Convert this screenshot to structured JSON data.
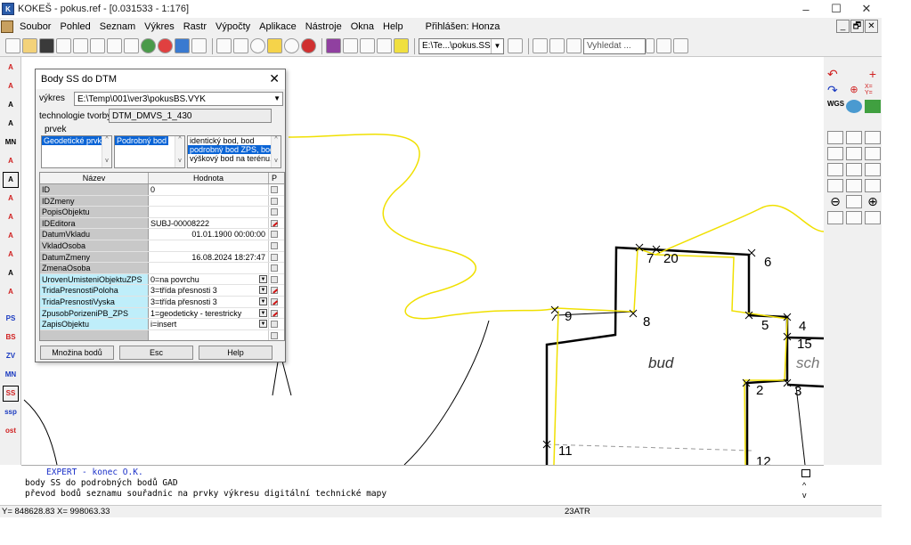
{
  "window": {
    "title": "KOKEŠ - pokus.ref - [0.031533 - 1:176]",
    "controls": [
      "–",
      "☐",
      "✕"
    ]
  },
  "menu": {
    "items": [
      "Soubor",
      "Pohled",
      "Seznam",
      "Výkres",
      "Rastr",
      "Výpočty",
      "Aplikace",
      "Nástroje",
      "Okna",
      "Help"
    ],
    "user": "Přihlášen: Honza",
    "mdi": [
      "_",
      "🗗",
      "✕"
    ]
  },
  "toolbar": {
    "path_combo": "E:\\Te...\\pokus.SS",
    "search_placeholder": "Vyhledat ..."
  },
  "left_toolbar": [
    "A",
    "A",
    "A",
    "A",
    "MN",
    "A",
    "A",
    "A",
    "A",
    "A",
    "A",
    "A",
    "A",
    "PS",
    "BS",
    "ZV",
    "MN",
    "SS",
    "ssp",
    "ost"
  ],
  "dialog": {
    "title": "Body SS do DTM",
    "vykres_label": "výkres",
    "vykres_value": "E:\\Temp\\001\\ver3\\pokusBS.VYK",
    "technologie_label": "technologie tvorby",
    "technologie_value": "DTM_DMVS_1_430",
    "prvek_label": "prvek",
    "list1": [
      "Geodetické prvky"
    ],
    "list2": [
      "Podrobný bod"
    ],
    "list3": [
      "identický bod, bod",
      "podrobný bod ZPS, bod",
      "výškový bod na terénu,"
    ],
    "grid_headers": [
      "Název",
      "Hodnota",
      "P"
    ],
    "rows": [
      {
        "name": "ID",
        "value": "0",
        "align": "left",
        "dd": false,
        "p": "plain",
        "cyan": false
      },
      {
        "name": "IDZmeny",
        "value": "",
        "align": "left",
        "dd": false,
        "p": "plain",
        "cyan": false
      },
      {
        "name": "PopisObjektu",
        "value": "",
        "align": "left",
        "dd": false,
        "p": "plain",
        "cyan": false
      },
      {
        "name": "IDEditora",
        "value": "SUBJ-00008222",
        "align": "left",
        "dd": false,
        "p": "red",
        "cyan": false
      },
      {
        "name": "DatumVkladu",
        "value": "01.01.1900 00:00:00",
        "align": "right",
        "dd": false,
        "p": "plain",
        "cyan": false
      },
      {
        "name": "VkladOsoba",
        "value": "",
        "align": "left",
        "dd": false,
        "p": "plain",
        "cyan": false
      },
      {
        "name": "DatumZmeny",
        "value": "16.08.2024 18:27:47",
        "align": "right",
        "dd": false,
        "p": "plain",
        "cyan": false
      },
      {
        "name": "ZmenaOsoba",
        "value": "",
        "align": "left",
        "dd": false,
        "p": "plain",
        "cyan": false
      },
      {
        "name": "UrovenUmisteniObjektuZPS",
        "value": "0=na povrchu",
        "align": "left",
        "dd": true,
        "p": "plain",
        "cyan": true
      },
      {
        "name": "TridaPresnostiPoloha",
        "value": "3=třída přesnosti 3",
        "align": "left",
        "dd": true,
        "p": "red",
        "cyan": true
      },
      {
        "name": "TridaPresnostiVyska",
        "value": "3=třída přesnosti 3",
        "align": "left",
        "dd": true,
        "p": "red",
        "cyan": true
      },
      {
        "name": "ZpusobPorizeniPB_ZPS",
        "value": "1=geodeticky - terestricky",
        "align": "left",
        "dd": true,
        "p": "red",
        "cyan": true
      },
      {
        "name": "ZapisObjektu",
        "value": "i=insert",
        "align": "left",
        "dd": true,
        "p": "plain",
        "cyan": true
      },
      {
        "name": "",
        "value": "",
        "align": "left",
        "dd": false,
        "p": "plain",
        "cyan": false
      }
    ],
    "buttons": [
      "Množina bodů",
      "Esc",
      "Help"
    ]
  },
  "map": {
    "labels": [
      "7",
      "20",
      "6",
      "9",
      "8",
      "5",
      "4",
      "15",
      "bud",
      "sch",
      "2",
      "3",
      "11",
      "12"
    ]
  },
  "console": {
    "lines": [
      "EXPERT - konec O.K.",
      "body SS do podrobných bodů GAD",
      "převod bodů seznamu souřadnic na prvky výkresu digitální technické mapy"
    ]
  },
  "status": {
    "y": "Y=  848628.83",
    "x": "X=  998063.33",
    "layer": "23ATR"
  }
}
